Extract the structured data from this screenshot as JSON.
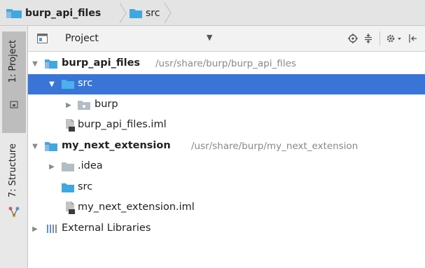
{
  "breadcrumb": {
    "items": [
      {
        "label": "burp_api_files",
        "icon": "module-folder-icon"
      },
      {
        "label": "src",
        "icon": "source-folder-icon"
      }
    ]
  },
  "side_strip": {
    "tabs": [
      {
        "label": "1: Project",
        "active": true
      },
      {
        "label": "7: Structure",
        "active": false
      }
    ]
  },
  "project_panel": {
    "title": "Project",
    "toolbar_icons": [
      "target-icon",
      "collapse-all-icon",
      "gear-icon",
      "hide-icon"
    ]
  },
  "tree": {
    "rows": [
      {
        "label": "burp_api_files",
        "path": "/usr/share/burp/burp_api_files",
        "bold": true,
        "expanded": true,
        "icon": "module-folder-icon"
      },
      {
        "label": "src",
        "selected": true,
        "expanded": true,
        "icon": "source-folder-icon"
      },
      {
        "label": "burp",
        "expanded": false,
        "icon": "package-icon"
      },
      {
        "label": "burp_api_files.iml",
        "icon": "iml-file-icon"
      },
      {
        "label": "my_next_extension",
        "path": "/usr/share/burp/my_next_extension",
        "bold": true,
        "expanded": true,
        "icon": "module-folder-icon"
      },
      {
        "label": ".idea",
        "expanded": false,
        "icon": "folder-icon"
      },
      {
        "label": "src",
        "icon": "source-folder-icon"
      },
      {
        "label": "my_next_extension.iml",
        "icon": "iml-file-icon"
      },
      {
        "label": "External Libraries",
        "expanded": false,
        "icon": "libraries-icon"
      }
    ]
  },
  "colors": {
    "selection": "#3875d6",
    "folder_blue": "#40a8e0",
    "folder_grey": "#b4bcc4",
    "path_text": "#888888"
  }
}
